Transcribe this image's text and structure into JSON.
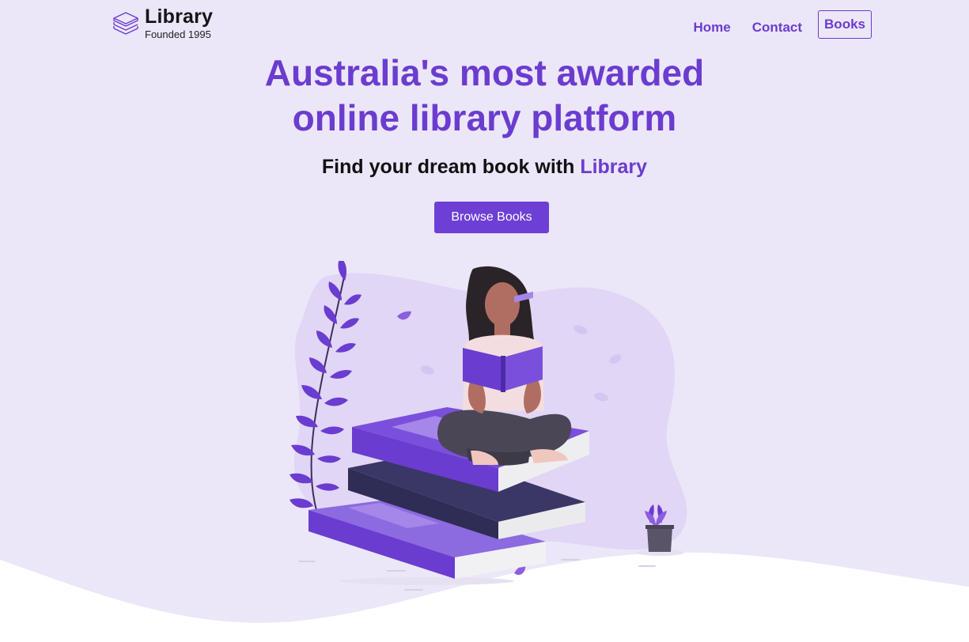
{
  "brand": {
    "name": "Library",
    "tagline": "Founded 1995",
    "icon": "books-stack-icon"
  },
  "nav": {
    "home": "Home",
    "contact": "Contact",
    "books": "Books"
  },
  "hero": {
    "title_line1": "Australia's most awarded",
    "title_line2": "online library platform",
    "subtitle_prefix": "Find your dream book with ",
    "subtitle_accent": "Library",
    "cta": "Browse Books"
  },
  "colors": {
    "accent": "#6a3ccf",
    "background": "#ece6f9",
    "blob": "#e1d6f5"
  }
}
